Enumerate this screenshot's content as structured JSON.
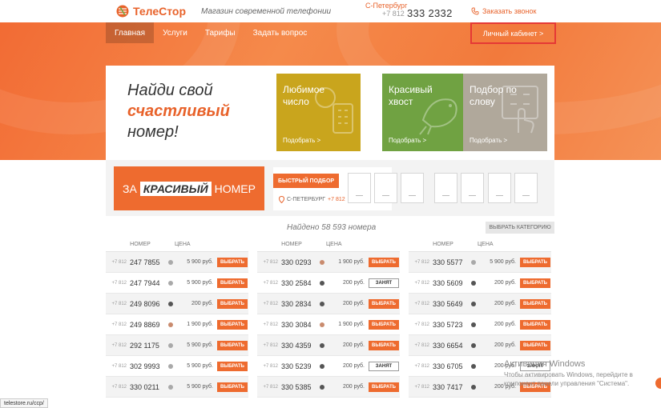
{
  "header": {
    "brand": "ТелеСтор",
    "tagline": "Магазин современной телефонии",
    "city": "С-Петербург",
    "phone_prefix": "+7 812",
    "phone_number": "333 2332",
    "callback_label": "Заказать звонок"
  },
  "nav": {
    "items": [
      "Главная",
      "Услуги",
      "Тарифы",
      "Задать вопрос"
    ],
    "active": "Главная",
    "cabinet_label": "Личный кабинет >"
  },
  "hero": {
    "line1": "Найди свой",
    "line2": "счастливый",
    "line3": "номер!",
    "tiles": [
      {
        "label": "Любимое число",
        "link": "Подобрать >",
        "color": "#c9a51d",
        "icon": "phone-keypad-icon"
      },
      {
        "label": "Красивый хвост",
        "link": "Подобрать >",
        "color": "#70a242",
        "icon": "bird-icon"
      },
      {
        "label": "Подбор по слову",
        "link": "Подобрать >",
        "color": "#b0a89b",
        "icon": "hand-touch-icon"
      }
    ]
  },
  "search": {
    "promo_prefix": "ЗА",
    "promo_highlight": "КРАСИВЫЙ",
    "promo_suffix": "НОМЕР",
    "fast_label": "БЫСТРЫЙ ПОДБОР",
    "city_label": "С-ПЕТЕРБУРГ",
    "city_code": "+7 812"
  },
  "results": {
    "found_text": "Найдено 58 593 номера",
    "category_button": "ВЫБРАТЬ КАТЕГОРИЮ",
    "col_number": "НОМЕР",
    "col_price": "ЦЕНА",
    "prefix": "+7 812",
    "buy_label": "ВЫБРАТЬ",
    "taken_label": "ЗАНЯТ",
    "columns": [
      [
        {
          "number": "247 7855",
          "price": "5 900 руб.",
          "dot": "#a9a9a9",
          "status": "buy"
        },
        {
          "number": "247 7944",
          "price": "5 900 руб.",
          "dot": "#a9a9a9",
          "status": "buy"
        },
        {
          "number": "249 8096",
          "price": "200 руб.",
          "dot": "#555555",
          "status": "buy"
        },
        {
          "number": "249 8869",
          "price": "1 900 руб.",
          "dot": "#c98b6e",
          "status": "buy"
        },
        {
          "number": "292 1175",
          "price": "5 900 руб.",
          "dot": "#a9a9a9",
          "status": "buy"
        },
        {
          "number": "302 9993",
          "price": "5 900 руб.",
          "dot": "#a9a9a9",
          "status": "buy"
        },
        {
          "number": "330 0211",
          "price": "5 900 руб.",
          "dot": "#a9a9a9",
          "status": "buy"
        }
      ],
      [
        {
          "number": "330 0293",
          "price": "1 900 руб.",
          "dot": "#c98b6e",
          "status": "buy"
        },
        {
          "number": "330 2584",
          "price": "200 руб.",
          "dot": "#555555",
          "status": "taken"
        },
        {
          "number": "330 2834",
          "price": "200 руб.",
          "dot": "#555555",
          "status": "buy"
        },
        {
          "number": "330 3084",
          "price": "1 900 руб.",
          "dot": "#c98b6e",
          "status": "buy"
        },
        {
          "number": "330 4359",
          "price": "200 руб.",
          "dot": "#555555",
          "status": "buy"
        },
        {
          "number": "330 5239",
          "price": "200 руб.",
          "dot": "#555555",
          "status": "taken"
        },
        {
          "number": "330 5385",
          "price": "200 руб.",
          "dot": "#555555",
          "status": "buy"
        }
      ],
      [
        {
          "number": "330 5577",
          "price": "5 900 руб.",
          "dot": "#a9a9a9",
          "status": "buy"
        },
        {
          "number": "330 5609",
          "price": "200 руб.",
          "dot": "#555555",
          "status": "buy"
        },
        {
          "number": "330 5649",
          "price": "200 руб.",
          "dot": "#555555",
          "status": "buy"
        },
        {
          "number": "330 5723",
          "price": "200 руб.",
          "dot": "#555555",
          "status": "buy"
        },
        {
          "number": "330 6654",
          "price": "200 руб.",
          "dot": "#555555",
          "status": "buy"
        },
        {
          "number": "330 6705",
          "price": "200 руб.",
          "dot": "#555555",
          "status": "taken"
        },
        {
          "number": "330 7417",
          "price": "200 руб.",
          "dot": "#555555",
          "status": "buy"
        }
      ]
    ]
  },
  "watermark": {
    "title": "Активация Windows",
    "body": "Чтобы активировать Windows, перейдите в компонент панели управления \"Система\"."
  },
  "statusbar": {
    "url": "telestore.ru/ccp/"
  }
}
